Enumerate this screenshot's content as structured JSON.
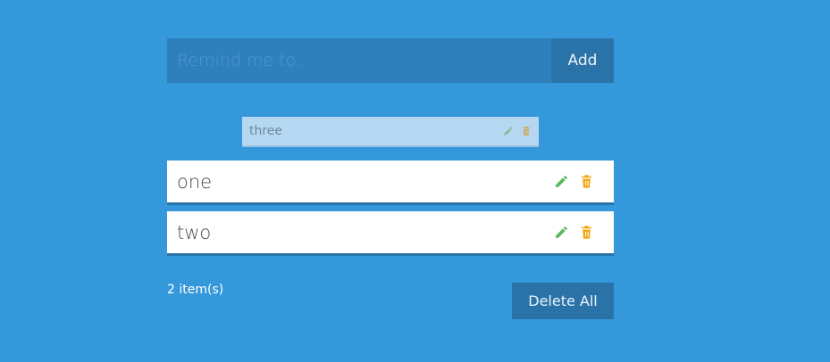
{
  "input": {
    "placeholder": "Remind me to..",
    "value": ""
  },
  "add_button_label": "Add",
  "dragged_item": {
    "text": "three",
    "edit_icon": "pencil-icon",
    "delete_icon": "trash-icon"
  },
  "todos": [
    {
      "text": "one",
      "edit_icon": "pencil-icon",
      "delete_icon": "trash-icon"
    },
    {
      "text": "two",
      "edit_icon": "pencil-icon",
      "delete_icon": "trash-icon"
    }
  ],
  "footer": {
    "count_text": "2 item(s)",
    "delete_all_label": "Delete All"
  },
  "colors": {
    "background": "#3498db",
    "input_bg": "#2e80bd",
    "button_bg": "#2a73a8",
    "edit_icon": "#5cb85c",
    "delete_icon": "#f0a30a"
  }
}
